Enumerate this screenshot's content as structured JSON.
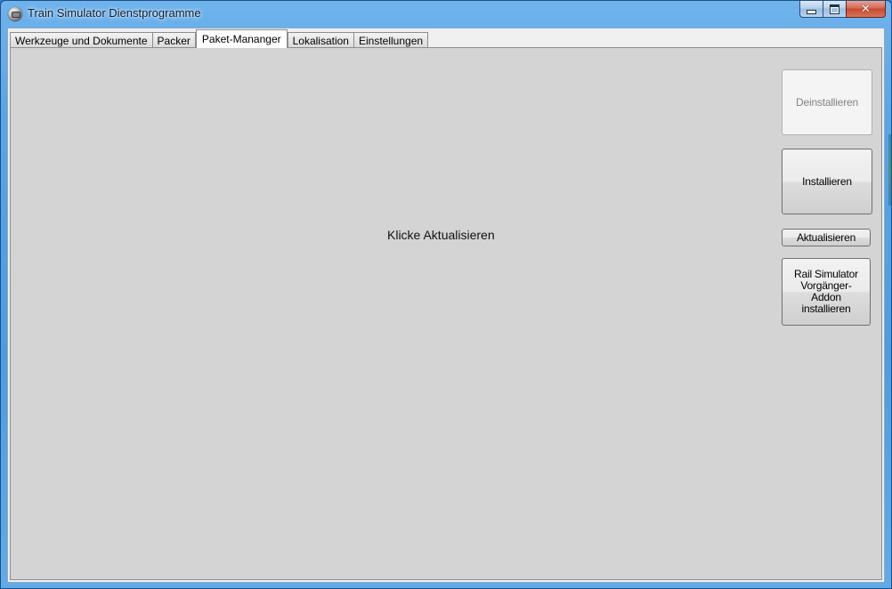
{
  "window": {
    "title": "Train Simulator Dienstprogramme",
    "app_icon": "train-simulator-icon",
    "controls": {
      "minimize_icon": "minimize-icon",
      "maximize_icon": "maximize-icon",
      "close_icon": "close-icon",
      "close_glyph": "✕"
    }
  },
  "tabs": [
    {
      "label": "Werkzeuge und Dokumente",
      "active": false
    },
    {
      "label": "Packer",
      "active": false
    },
    {
      "label": "Paket-Mananger",
      "active": true
    },
    {
      "label": "Lokalisation",
      "active": false
    },
    {
      "label": "Einstellungen",
      "active": false
    }
  ],
  "package_manager": {
    "empty_message": "Klicke Aktualisieren",
    "buttons": {
      "uninstall": {
        "label": "Deinstallieren",
        "enabled": false
      },
      "install": {
        "label": "Installieren",
        "enabled": true
      },
      "refresh": {
        "label": "Aktualisieren",
        "enabled": true
      },
      "legacy_line1": "Rail Simulator",
      "legacy_line2": "Vorgänger-Addon",
      "legacy_line3": "installieren"
    }
  },
  "colors": {
    "panel_bg": "#d4d4d4",
    "title_bar": "#5aa4e6",
    "close_button": "#c44a2f"
  }
}
